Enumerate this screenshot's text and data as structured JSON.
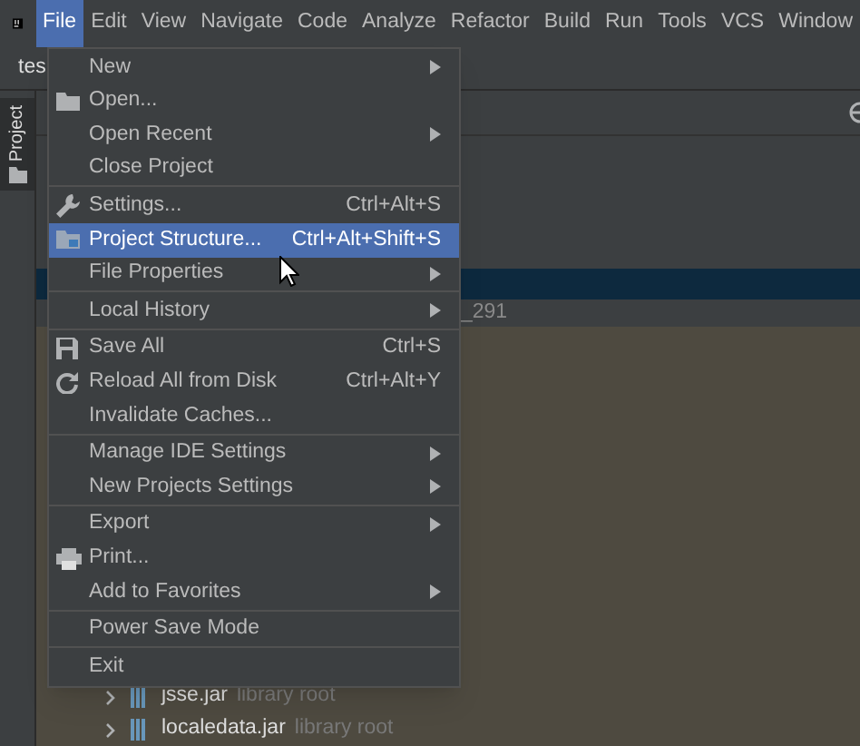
{
  "menubar": [
    {
      "label": "File",
      "selected": true
    },
    {
      "label": "Edit",
      "selected": false
    },
    {
      "label": "View",
      "selected": false
    },
    {
      "label": "Navigate",
      "selected": false
    },
    {
      "label": "Code",
      "selected": false
    },
    {
      "label": "Analyze",
      "selected": false
    },
    {
      "label": "Refactor",
      "selected": false
    },
    {
      "label": "Build",
      "selected": false
    },
    {
      "label": "Run",
      "selected": false
    },
    {
      "label": "Tools",
      "selected": false
    },
    {
      "label": "VCS",
      "selected": false
    },
    {
      "label": "Window",
      "selected": false
    }
  ],
  "nav_tab": "tes",
  "tool_window_tab": "Project",
  "tree": {
    "partial_row": "_291",
    "rows": [
      {
        "name": "jsse.jar",
        "note": "library root"
      },
      {
        "name": "localedata.jar",
        "note": "library root"
      }
    ]
  },
  "file_menu": [
    [
      {
        "label": "New",
        "submenu": true,
        "selected": false
      },
      {
        "label": "Open...",
        "kind": "folder",
        "selected": false
      },
      {
        "label": "Open Recent",
        "submenu": true,
        "selected": false
      },
      {
        "label": "Close Project",
        "selected": false
      }
    ],
    [
      {
        "label": "Settings...",
        "kind": "wrench",
        "shortcut": "Ctrl+Alt+S",
        "selected": false
      },
      {
        "label": "Project Structure...",
        "kind": "structure",
        "shortcut": "Ctrl+Alt+Shift+S",
        "selected": true
      },
      {
        "label": "File Properties",
        "submenu": true,
        "selected": false
      }
    ],
    [
      {
        "label": "Local History",
        "submenu": true,
        "selected": false
      }
    ],
    [
      {
        "label": "Save All",
        "kind": "save",
        "shortcut": "Ctrl+S",
        "selected": false
      },
      {
        "label": "Reload All from Disk",
        "kind": "reload",
        "shortcut": "Ctrl+Alt+Y",
        "selected": false
      },
      {
        "label": "Invalidate Caches...",
        "selected": false
      }
    ],
    [
      {
        "label": "Manage IDE Settings",
        "submenu": true,
        "selected": false
      },
      {
        "label": "New Projects Settings",
        "submenu": true,
        "selected": false
      }
    ],
    [
      {
        "label": "Export",
        "submenu": true,
        "selected": false
      },
      {
        "label": "Print...",
        "kind": "print",
        "selected": false
      },
      {
        "label": "Add to Favorites",
        "submenu": true,
        "selected": false
      }
    ],
    [
      {
        "label": "Power Save Mode",
        "selected": false
      }
    ],
    [
      {
        "label": "Exit",
        "selected": false
      }
    ]
  ]
}
